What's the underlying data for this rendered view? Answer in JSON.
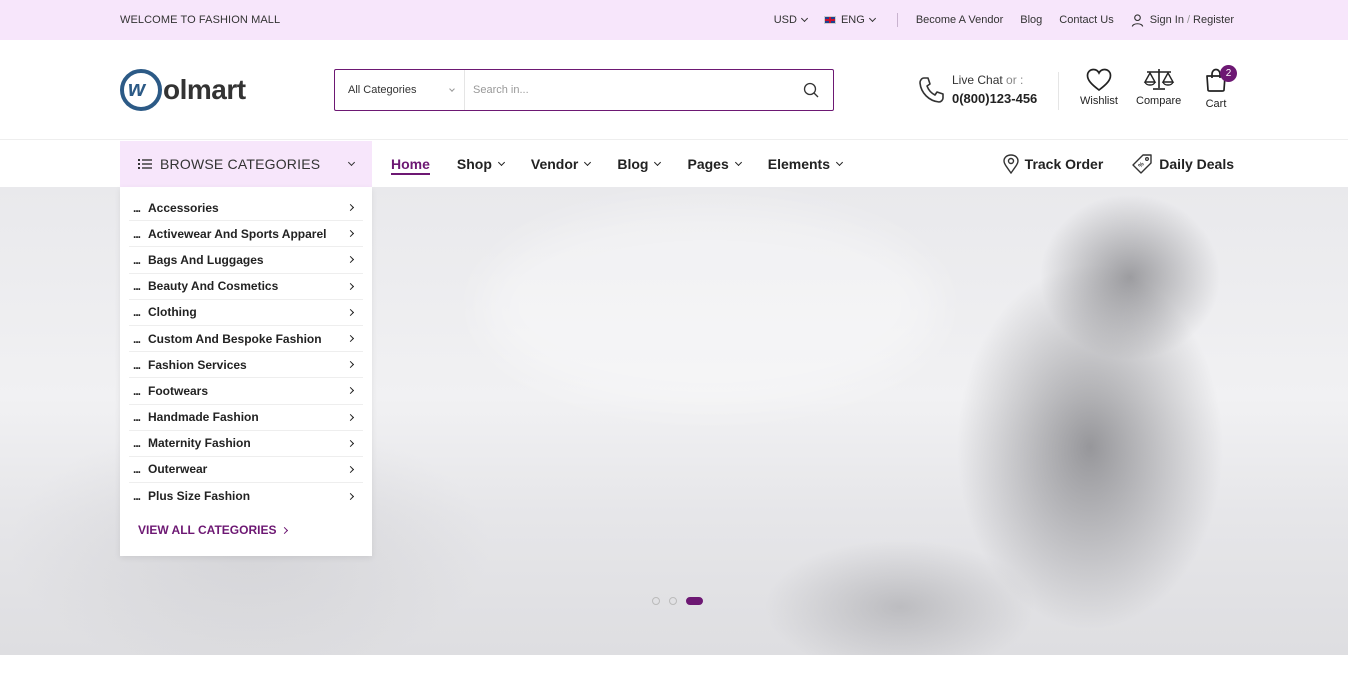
{
  "topbar": {
    "welcome": "WELCOME TO FASHION MALL",
    "currency": "USD",
    "language": "ENG",
    "links": [
      "Become A Vendor",
      "Blog",
      "Contact Us"
    ],
    "sign_in": "Sign In",
    "slash": "/",
    "register": "Register"
  },
  "header": {
    "logo_mark": "w",
    "logo_text": "olmart",
    "search": {
      "category": "All Categories",
      "placeholder": "Search in..."
    },
    "live_chat": {
      "label": "Live Chat",
      "or": "or :",
      "phone": "0(800)123-456"
    },
    "wishlist": "Wishlist",
    "compare": "Compare",
    "cart": "Cart",
    "cart_count": "2"
  },
  "nav": {
    "browse": "BROWSE CATEGORIES",
    "menu": [
      "Home",
      "Shop",
      "Vendor",
      "Blog",
      "Pages",
      "Elements"
    ],
    "track_order": "Track Order",
    "daily_deals": "Daily Deals"
  },
  "categories": {
    "bullet": "...",
    "items": [
      "Accessories",
      "Activewear And Sports Apparel",
      "Bags And Luggages",
      "Beauty And Cosmetics",
      "Clothing",
      "Custom And Bespoke Fashion",
      "Fashion Services",
      "Footwears",
      "Handmade Fashion",
      "Maternity Fashion",
      "Outerwear",
      "Plus Size Fashion"
    ],
    "view_all": "VIEW ALL CATEGORIES"
  },
  "slider": {
    "active_slide": 3,
    "slide_count": 3
  },
  "colors": {
    "accent": "#6d1873",
    "topbar_bg": "#f7e6fb",
    "logo_blue": "#2c5a86"
  }
}
